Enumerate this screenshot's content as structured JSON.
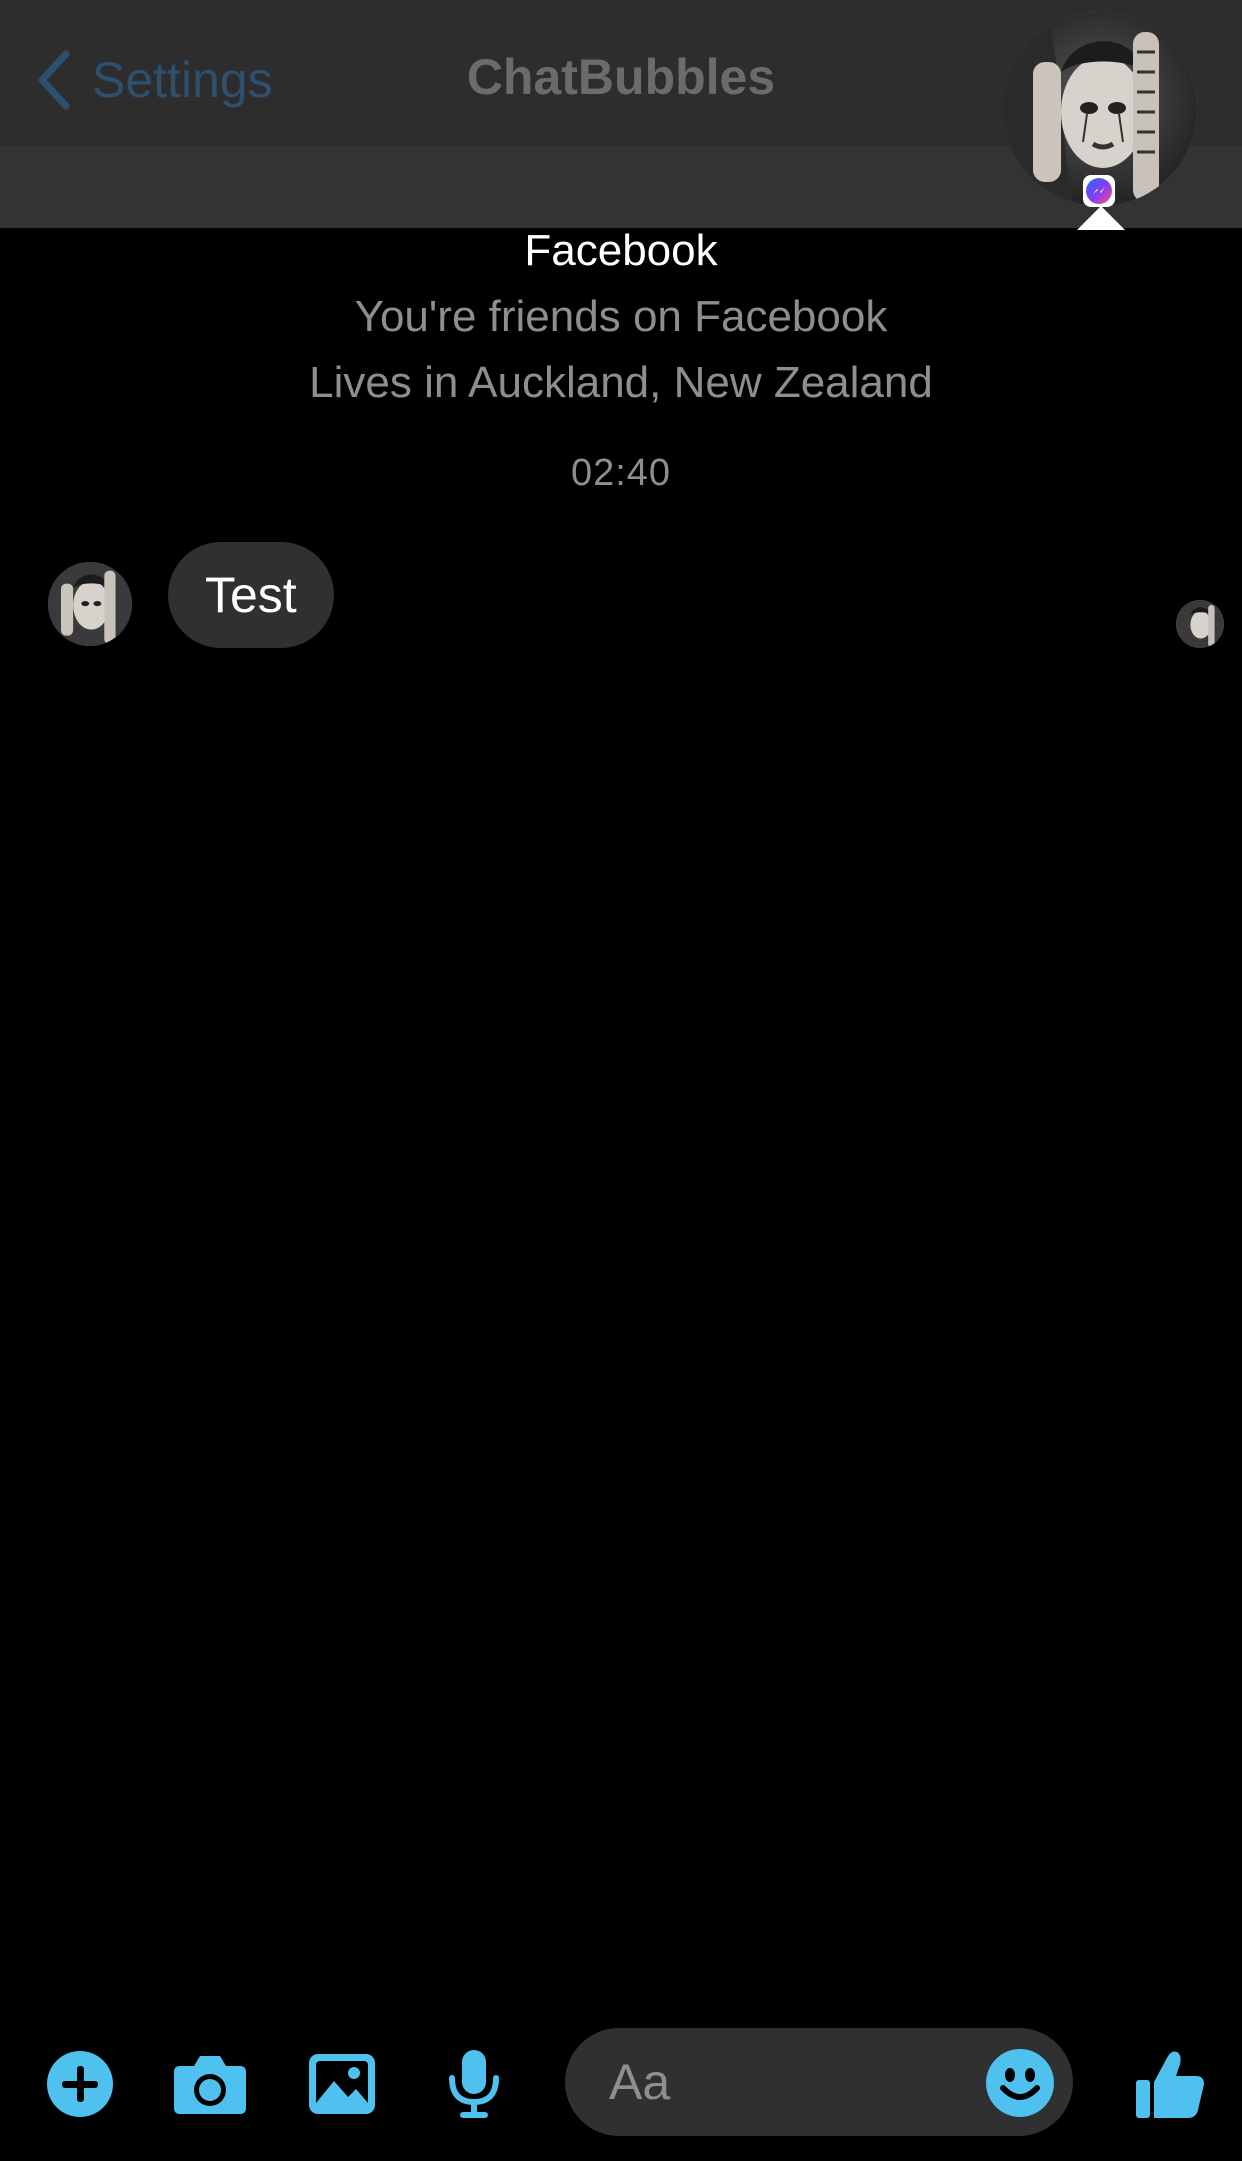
{
  "nav": {
    "back_label": "Settings",
    "title": "ChatBubbles"
  },
  "profile": {
    "source": "Facebook",
    "friends_line": "You're friends on Facebook",
    "location_line": "Lives in Auckland, New Zealand"
  },
  "conversation": {
    "timestamp": "02:40",
    "messages": [
      {
        "text": "Test",
        "from": "contact"
      }
    ]
  },
  "composer": {
    "placeholder": "Aa"
  },
  "icons": {
    "add": "plus-circle-icon",
    "camera": "camera-icon",
    "gallery": "image-icon",
    "voice": "microphone-icon",
    "emoji": "smiley-icon",
    "like": "thumbs-up-icon",
    "badge": "messenger-icon"
  },
  "colors": {
    "accent": "#4fc1ee",
    "background": "#000000",
    "bubble": "#303030",
    "muted_text": "#8e8e8e"
  }
}
